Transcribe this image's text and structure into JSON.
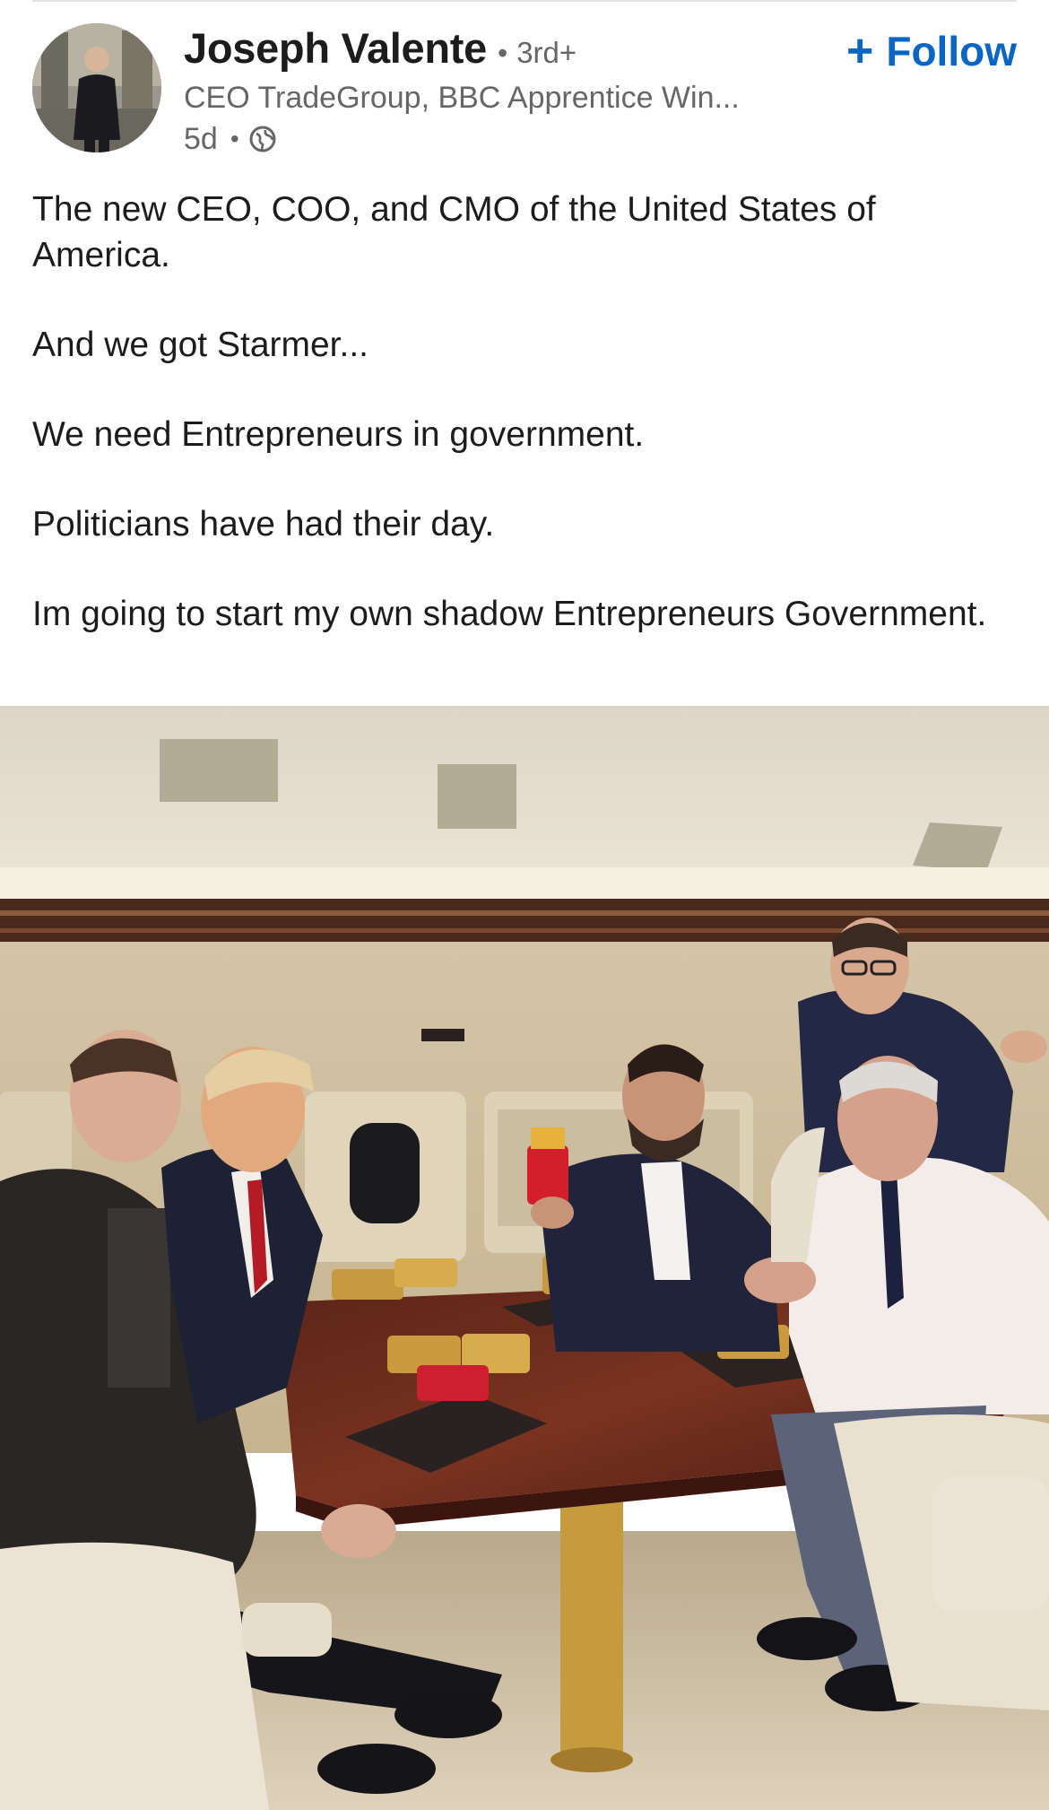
{
  "post": {
    "author": {
      "name": "Joseph Valente",
      "separator": "•",
      "connection_degree": "3rd+",
      "headline": "CEO TradeGroup, BBC Apprentice Win...",
      "posted_ago": "5d",
      "visibility_separator": "•",
      "visibility_icon": "globe-icon"
    },
    "follow_button": {
      "icon": "plus-icon",
      "label": "Follow"
    },
    "body_paragraphs": [
      "The new CEO, COO, and CMO of the United States of America.",
      "And we got Starmer...",
      "We need Entrepreneurs in government.",
      "Politicians have had their day.",
      "Im going to start my own shadow Entrepreneurs Government."
    ],
    "image": {
      "type": "photo"
    }
  },
  "colors": {
    "link_blue": "#0a66c2",
    "text_primary": "#1c1c1c",
    "text_secondary": "#666666",
    "background": "#ffffff"
  }
}
